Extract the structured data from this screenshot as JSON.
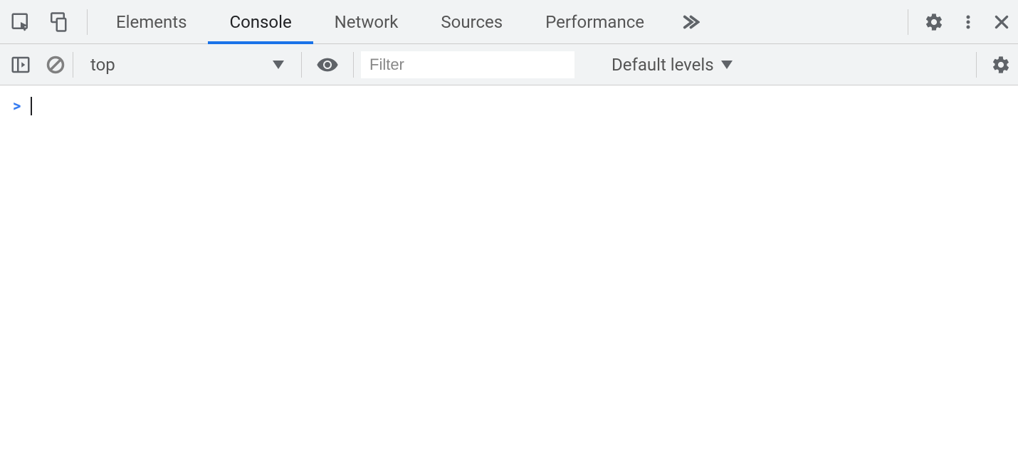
{
  "tabs": {
    "elements": "Elements",
    "console": "Console",
    "network": "Network",
    "sources": "Sources",
    "performance": "Performance",
    "active": "console"
  },
  "console_toolbar": {
    "context_selected": "top",
    "filter_placeholder": "Filter",
    "levels_label": "Default levels"
  },
  "prompt": {
    "caret": ">"
  }
}
